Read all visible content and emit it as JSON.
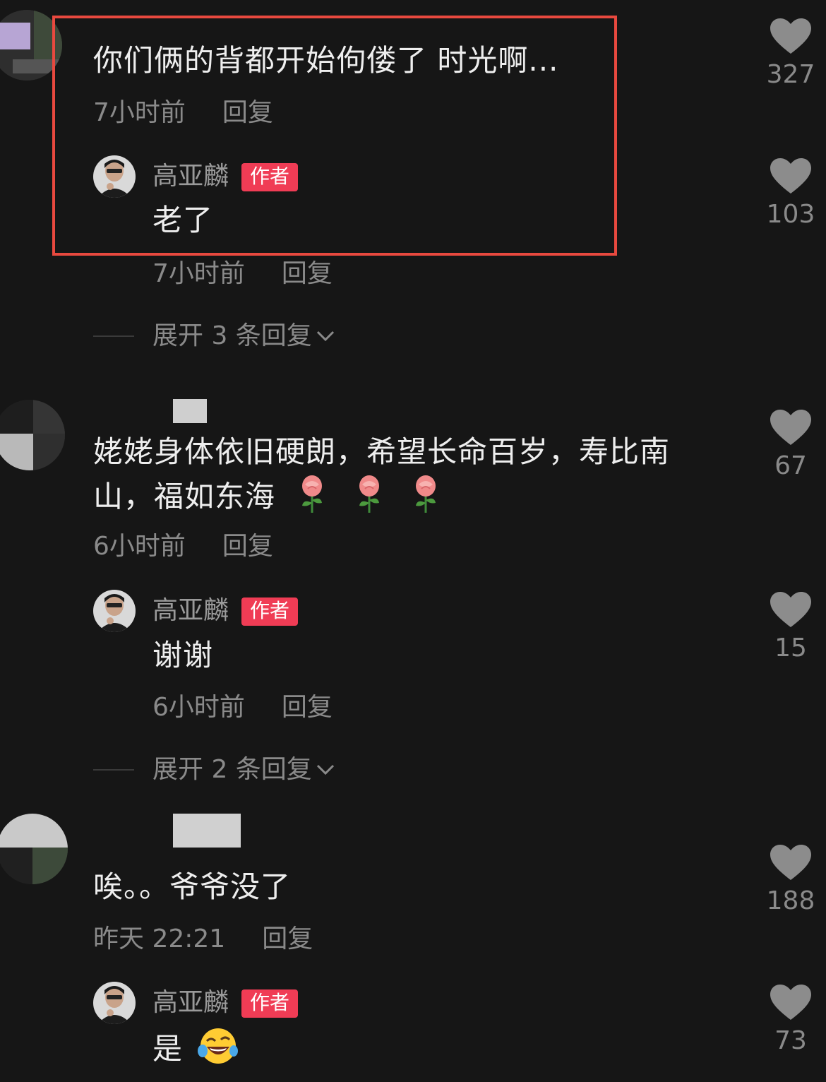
{
  "comments": [
    {
      "text": "你们俩的背都开始佝偻了 时光啊...",
      "time": "7小时前",
      "reply_label": "回复",
      "likes": "327",
      "author_reply": {
        "name": "高亚麟",
        "badge": "作者",
        "text": "老了",
        "time": "7小时前",
        "reply_label": "回复",
        "likes": "103"
      },
      "expand_label": "展开 3 条回复"
    },
    {
      "text_line1": "姥姥身体依旧硬朗，希望长命百岁，寿比南",
      "text_line2": "山，福如东海",
      "emoji": "rose-emoji",
      "time": "6小时前",
      "reply_label": "回复",
      "likes": "67",
      "author_reply": {
        "name": "高亚麟",
        "badge": "作者",
        "text": "谢谢",
        "time": "6小时前",
        "reply_label": "回复",
        "likes": "15"
      },
      "expand_label": "展开 2 条回复"
    },
    {
      "text": "唉。。爷爷没了",
      "time": "昨天 22:21",
      "reply_label": "回复",
      "likes": "188",
      "author_reply": {
        "name": "高亚麟",
        "badge": "作者",
        "text": "是",
        "emoji": "laughing-tears-emoji",
        "likes": "73"
      }
    }
  ],
  "colors": {
    "background": "#161616",
    "badge": "#f03c55",
    "highlight": "#e8493f",
    "text_primary": "#eeeeee",
    "text_secondary": "#8a8a8a"
  },
  "icons": [
    "heart-icon",
    "chevron-down-icon"
  ]
}
